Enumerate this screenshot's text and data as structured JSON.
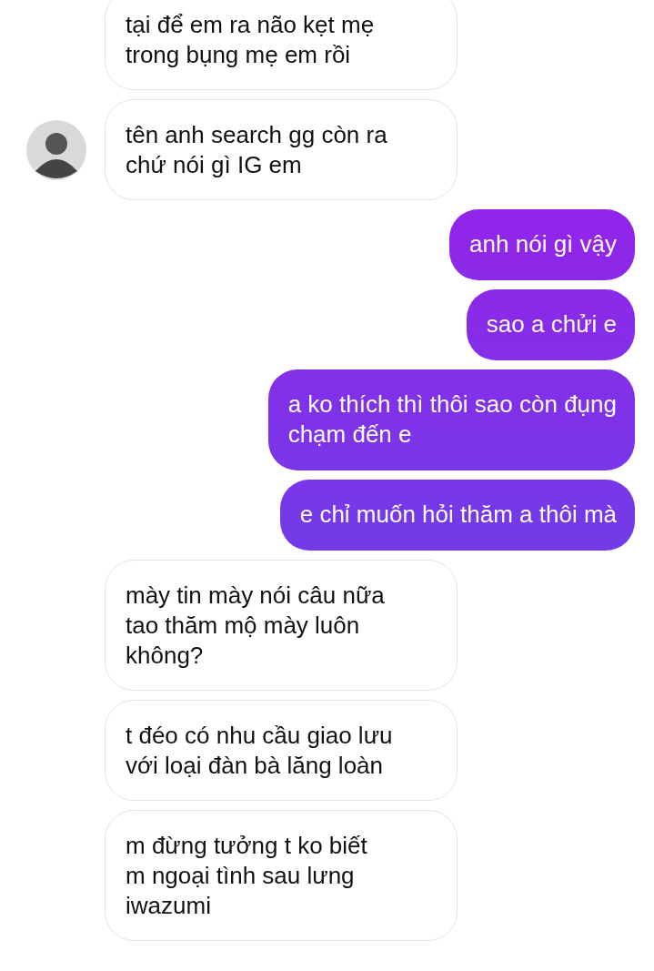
{
  "messages": [
    {
      "kind": "incoming",
      "text": "tại để em ra não kẹt mẹ\ntrong bụng mẹ em rồi",
      "show_avatar": false
    },
    {
      "kind": "incoming",
      "text": "tên anh search gg còn ra\nchứ nói gì IG em",
      "show_avatar": true
    },
    {
      "kind": "outgoing",
      "text": "anh nói gì vậy"
    },
    {
      "kind": "outgoing",
      "text": "sao a chửi e"
    },
    {
      "kind": "outgoing",
      "text": "a ko thích thì thôi sao còn đụng\nchạm đến e"
    },
    {
      "kind": "outgoing",
      "text": "e chỉ muốn hỏi thăm a thôi mà"
    },
    {
      "kind": "incoming",
      "text": "mày tin mày nói câu nữa\ntao thăm mộ mày luôn\nkhông?",
      "show_avatar": false
    },
    {
      "kind": "incoming",
      "text": "t đéo có nhu cầu giao lưu\nvới loại đàn bà lăng loàn",
      "show_avatar": false
    },
    {
      "kind": "incoming",
      "text": "m đừng tưởng t ko biết\nm ngoại tình sau lưng\niwazumi",
      "show_avatar": false
    }
  ]
}
